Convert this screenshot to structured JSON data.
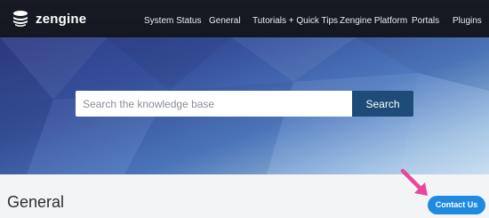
{
  "brand": {
    "name": "zengine",
    "logo_icon": "stacked-layers-logo"
  },
  "nav": {
    "items": [
      {
        "label": "System Status"
      },
      {
        "label": "General"
      },
      {
        "label": "Tutorials + Quick Tips"
      },
      {
        "label": "Zengine Platform"
      },
      {
        "label": "Portals"
      },
      {
        "label": "Plugins"
      }
    ]
  },
  "search": {
    "placeholder": "Search the knowledge base",
    "value": "",
    "button_label": "Search"
  },
  "main": {
    "page_title": "General",
    "contact_label": "Contact Us"
  },
  "colors": {
    "nav_bg": "#181b24",
    "search_button": "#1e4b77",
    "contact_button": "#1e8be0",
    "annotation_arrow": "#e8489a"
  }
}
